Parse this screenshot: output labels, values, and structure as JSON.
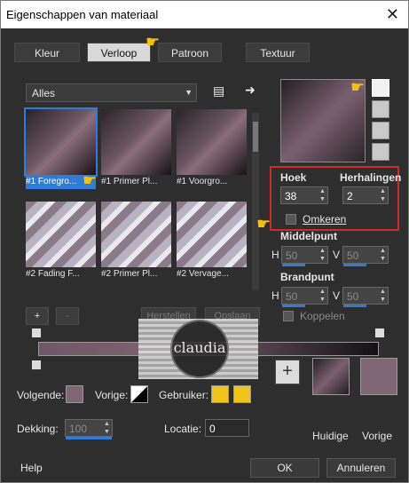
{
  "window": {
    "title": "Eigenschappen van materiaal",
    "close_glyph": "✕"
  },
  "tabs": [
    {
      "label": "Kleur",
      "active": false
    },
    {
      "label": "Verloop",
      "active": true
    },
    {
      "label": "Patroon",
      "active": false
    },
    {
      "label": "Textuur",
      "active": false
    }
  ],
  "category_dropdown": {
    "value": "Alles"
  },
  "gradients": [
    {
      "caption": "#1 Foregro...",
      "selected": true,
      "style": "gradient"
    },
    {
      "caption": "#1 Primer Pl...",
      "selected": false,
      "style": "gradient"
    },
    {
      "caption": "#1 Voorgro...",
      "selected": false,
      "style": "gradient"
    },
    {
      "caption": "#2 Fading F...",
      "selected": false,
      "style": "fading"
    },
    {
      "caption": "#2 Primer Pl...",
      "selected": false,
      "style": "fading"
    },
    {
      "caption": "#2 Vervage...",
      "selected": false,
      "style": "fading"
    }
  ],
  "settings": {
    "angle_label": "Hoek",
    "angle_value": "38",
    "repeats_label": "Herhalingen",
    "repeats_value": "2",
    "invert_label": "Omkeren",
    "center_label": "Middelpunt",
    "center_h_label": "H",
    "center_h_value": "50",
    "center_v_label": "V",
    "center_v_value": "50",
    "focal_label": "Brandpunt",
    "focal_h_label": "H",
    "focal_h_value": "50",
    "focal_v_label": "V",
    "focal_v_value": "50",
    "link_label": "Koppelen"
  },
  "editor": {
    "add_label": "+",
    "remove_label": "-",
    "reset_label": "Herstellen",
    "save_label": "Opslaan"
  },
  "color_row": {
    "next_label": "Volgende:",
    "prev_label": "Vorige:",
    "user_label": "Gebruiker:",
    "opacity_label": "Dekking:",
    "opacity_value": "100",
    "location_label": "Locatie:",
    "location_value": "0",
    "user_color_1": "#f2c318",
    "user_color_2": "#f2c318",
    "next_color": "#7e6675"
  },
  "swatches": {
    "add_label": "+",
    "current_label": "Huidige",
    "previous_label": "Vorige",
    "previous_color": "#7e6675"
  },
  "footer": {
    "help_label": "Help",
    "ok_label": "OK",
    "cancel_label": "Annuleren"
  },
  "watermark": {
    "text": "claudia"
  },
  "colors": {
    "accent": "#2e7cd8",
    "highlight_border": "#d12a2a",
    "pointer": "#f4c20d"
  }
}
